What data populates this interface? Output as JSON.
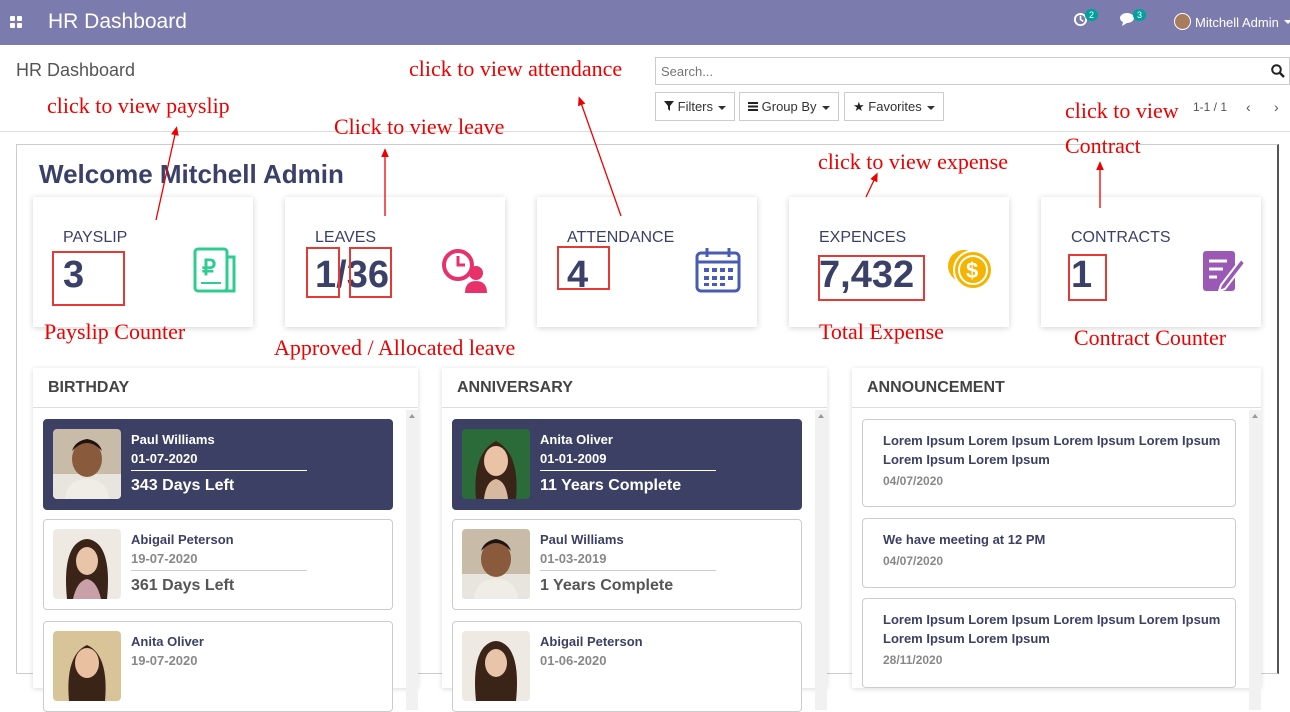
{
  "topbar": {
    "app_title": "HR Dashboard",
    "activity_count": "2",
    "message_count": "3",
    "user_name": "Mitchell Admin"
  },
  "control_panel": {
    "breadcrumb": "HR Dashboard",
    "search_placeholder": "Search...",
    "filters_label": "Filters",
    "group_by_label": "Group By",
    "favorites_label": "Favorites",
    "pager": "1-1 / 1",
    "prev": "‹",
    "next": "›"
  },
  "dashboard": {
    "welcome": "Welcome Mitchell Admin",
    "cards": [
      {
        "label": "PAYSLIP",
        "value": "3",
        "icon": "payslip-icon",
        "color": "#2ecc8f"
      },
      {
        "label": "LEAVES",
        "value": "1/36",
        "icon": "leave-clock-icon",
        "color": "#e8306b"
      },
      {
        "label": "ATTENDANCE",
        "value": "4",
        "icon": "calendar-icon",
        "color": "#4a5bb5"
      },
      {
        "label": "EXPENCES",
        "value": "7,432",
        "icon": "coins-dollar-icon",
        "color": "#f4b400"
      },
      {
        "label": "CONTRACTS",
        "value": "1",
        "icon": "contract-edit-icon",
        "color": "#9b59b6"
      }
    ]
  },
  "annotations": {
    "payslip_click": "click to view payslip",
    "leave_click": "Click to view leave",
    "attendance_click": "click to view attendance",
    "expense_click": "click to view expense",
    "contract_click_1": "click to view",
    "contract_click_2": "Contract",
    "payslip_counter": "Payslip Counter",
    "leave_counter": "Approved / Allocated leave",
    "total_expense": "Total Expense",
    "contract_counter": "Contract Counter"
  },
  "birthday": {
    "title": "BIRTHDAY",
    "items": [
      {
        "name": "Paul Williams",
        "date": "01-07-2020",
        "info": "343 Days Left"
      },
      {
        "name": "Abigail Peterson",
        "date": "19-07-2020",
        "info": "361 Days Left"
      },
      {
        "name": "Anita Oliver",
        "date": "19-07-2020",
        "info": ""
      }
    ]
  },
  "anniversary": {
    "title": "ANNIVERSARY",
    "items": [
      {
        "name": "Anita Oliver",
        "date": "01-01-2009",
        "info": "11 Years Complete"
      },
      {
        "name": "Paul Williams",
        "date": "01-03-2019",
        "info": "1 Years Complete"
      },
      {
        "name": "Abigail Peterson",
        "date": "01-06-2020",
        "info": ""
      }
    ]
  },
  "announcement": {
    "title": "ANNOUNCEMENT",
    "items": [
      {
        "text": "Lorem Ipsum Lorem Ipsum Lorem Ipsum Lorem Ipsum Lorem Ipsum Lorem Ipsum",
        "date": "04/07/2020"
      },
      {
        "text": "We have meeting at 12 PM",
        "date": "04/07/2020"
      },
      {
        "text": "Lorem Ipsum Lorem Ipsum Lorem Ipsum Lorem Ipsum Lorem Ipsum Lorem Ipsum",
        "date": "28/11/2020"
      }
    ]
  }
}
